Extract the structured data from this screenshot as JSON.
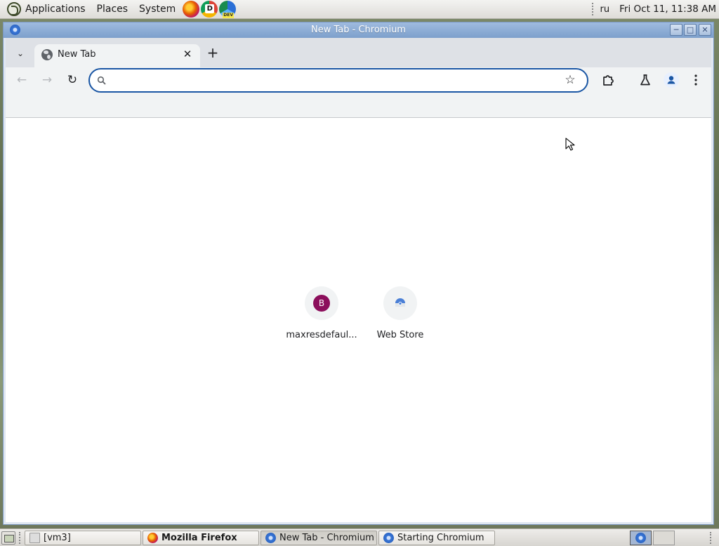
{
  "top_panel": {
    "menus": [
      "Applications",
      "Places",
      "System"
    ],
    "keyboard_layout": "ru",
    "clock": "Fri Oct 11, 11:38 AM"
  },
  "window": {
    "title": "New Tab - Chromium"
  },
  "browser": {
    "tabs": [
      {
        "title": "New Tab",
        "active": true
      }
    ],
    "omnibox": {
      "value": "",
      "placeholder": ""
    },
    "shortcuts": [
      {
        "letter": "B",
        "label": "maxresdefaul...",
        "color": "#8c0f5c"
      },
      {
        "label": "Web Store"
      }
    ],
    "accent_color": "#1a56a4"
  },
  "taskbar": {
    "tasks": [
      {
        "label": "[vm3]",
        "icon": "folder-icon"
      },
      {
        "label": "Mozilla Firefox",
        "icon": "firefox-icon"
      },
      {
        "label": "New Tab - Chromium",
        "icon": "chromium-icon",
        "active": true
      },
      {
        "label": "Starting Chromium",
        "icon": "chromium-icon"
      }
    ]
  }
}
